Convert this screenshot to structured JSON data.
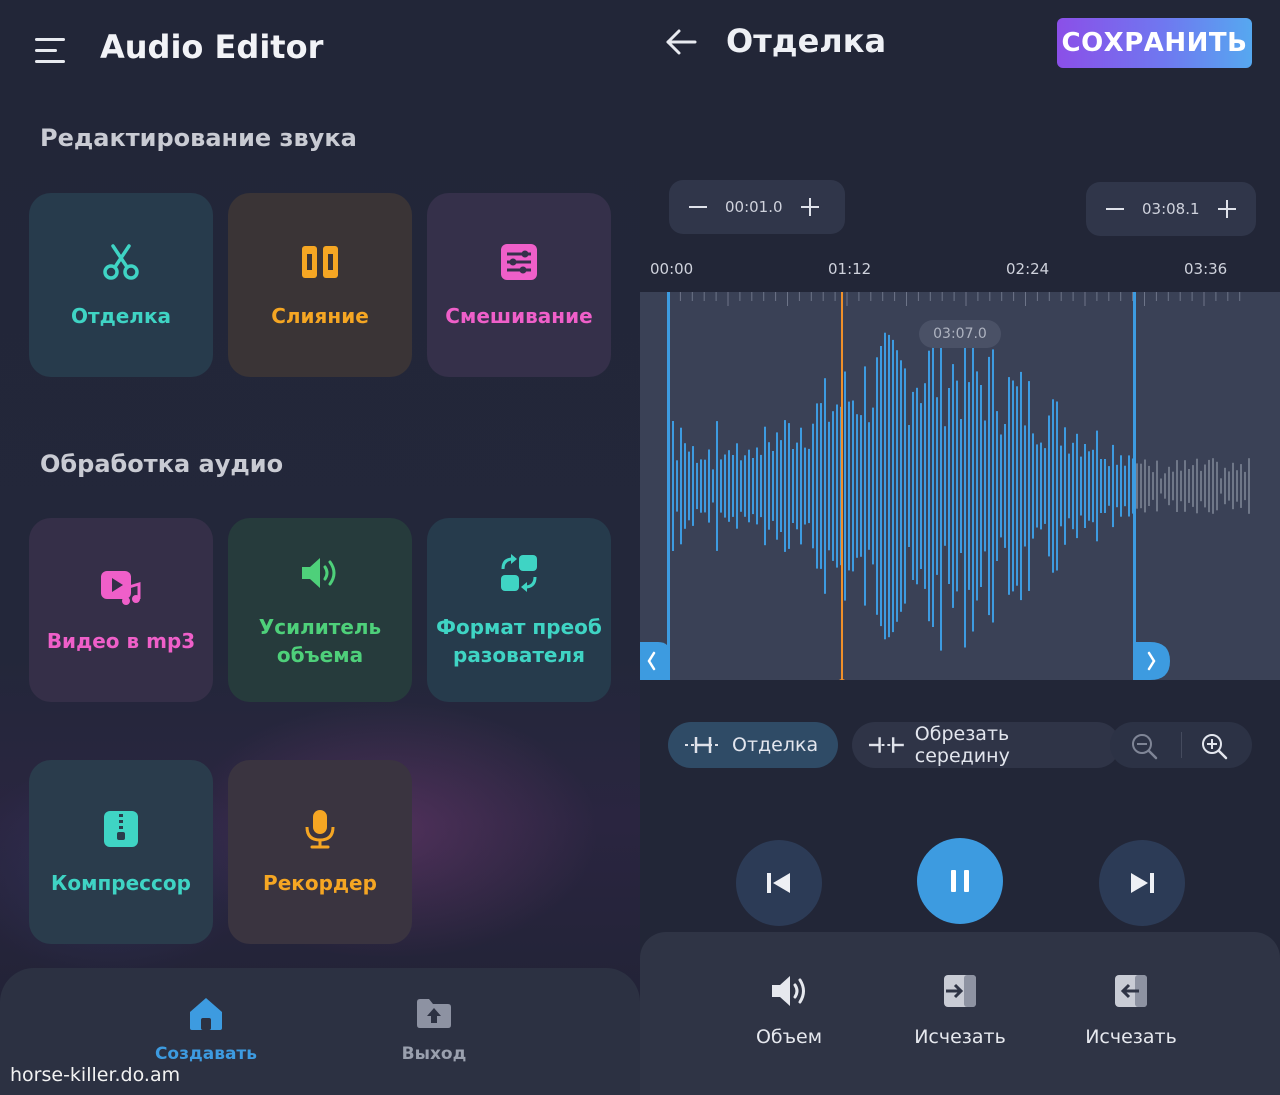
{
  "home": {
    "app_title": "Audio Editor",
    "section_editing": "Редактирование звука",
    "section_processing": "Обработка аудио",
    "cards": [
      {
        "label": "Отделка",
        "icon": "scissors-icon",
        "color": "#3fd4c4"
      },
      {
        "label": "Слияние",
        "icon": "merge-icon",
        "color": "#f5a623"
      },
      {
        "label": "Смешивание",
        "icon": "mixer-icon",
        "color": "#ef5fc9"
      },
      {
        "label": "Видео в mp3",
        "icon": "video-music-icon",
        "color": "#ef5fc9"
      },
      {
        "label": "Усилитель объема",
        "icon": "speaker-icon",
        "color": "#4ed07a"
      },
      {
        "label": "Формат преоб разователя",
        "icon": "format-convert-icon",
        "color": "#3fd4c4"
      },
      {
        "label": "Компрессор",
        "icon": "zip-icon",
        "color": "#3fd4c4"
      },
      {
        "label": "Рекордер",
        "icon": "microphone-icon",
        "color": "#f5a623"
      }
    ],
    "nav": {
      "create_label": "Создавать",
      "exit_label": "Выход"
    },
    "watermark": "horse-killer.do.am"
  },
  "editor": {
    "title": "Отделка",
    "save_label": "СОХРАНИТЬ",
    "start_time": "00:01.0",
    "end_time": "03:08.1",
    "ticks": [
      "00:00",
      "01:12",
      "02:24",
      "03:36"
    ],
    "selection_duration": "03:07.0",
    "chip_trim": "Отделка",
    "chip_cut_middle": "Обрезать середину",
    "tools": [
      {
        "label": "Объем",
        "icon": "volume-icon"
      },
      {
        "label": "Исчезать",
        "icon": "fade-in-icon"
      },
      {
        "label": "Исчезать",
        "icon": "fade-out-icon"
      }
    ],
    "colors": {
      "accent_blue": "#3d9be0",
      "playhead": "#f0902a",
      "waveform": "#3d9be0"
    }
  }
}
